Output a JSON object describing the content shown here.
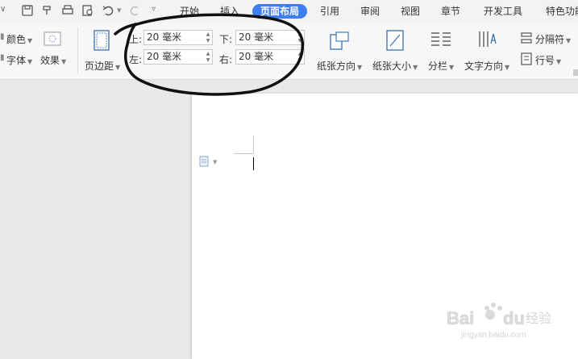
{
  "tabs": [
    {
      "label": "开始"
    },
    {
      "label": "插入"
    },
    {
      "label": "页面布局"
    },
    {
      "label": "引用"
    },
    {
      "label": "审阅"
    },
    {
      "label": "视图"
    },
    {
      "label": "章节"
    },
    {
      "label": "开发工具"
    },
    {
      "label": "特色功能"
    }
  ],
  "ribbon": {
    "color_label": "颜色",
    "font_label": "字体",
    "effect_label": "效果",
    "margins_label": "页边距",
    "top_label": "上:",
    "top_value": "20 毫米",
    "bottom_label": "下:",
    "bottom_value": "20 毫米",
    "left_label": "左:",
    "left_value": "20 毫米",
    "right_label": "右:",
    "right_value": "20 毫米",
    "orientation_label": "纸张方向",
    "size_label": "纸张大小",
    "columns_label": "分栏",
    "text_direction_label": "文字方向",
    "separator_label": "分隔符",
    "line_number_label": "行号"
  },
  "colors": {
    "accent": "#3d7ff3",
    "annotation": "#111111"
  },
  "watermark": {
    "logo_text": "Baidu经验",
    "url": "jingyan.baidu.com"
  }
}
